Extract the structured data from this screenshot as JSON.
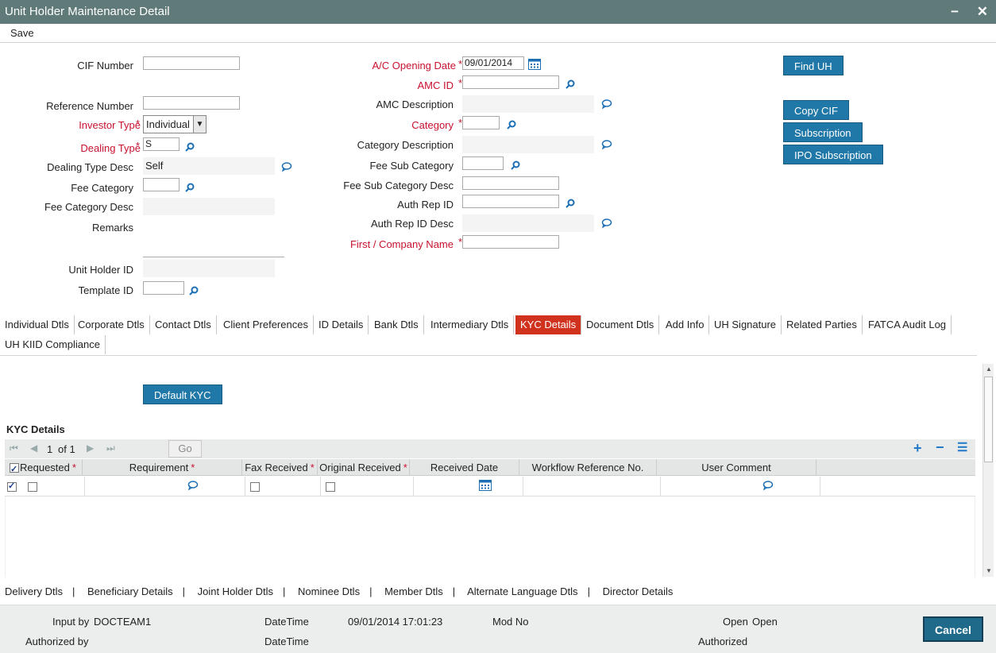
{
  "window": {
    "title": "Unit Holder Maintenance Detail",
    "minimize": "−",
    "close": "✕"
  },
  "menu": {
    "save": "Save"
  },
  "left": {
    "cif_number": "CIF Number",
    "reference_number": "Reference Number",
    "investor_type": "Investor Type",
    "investor_type_value": "Individual",
    "dealing_type": "Dealing Type",
    "dealing_type_value": "S",
    "dealing_type_desc": "Dealing Type Desc",
    "dealing_type_desc_value": "Self",
    "fee_category": "Fee Category",
    "fee_category_desc": "Fee Category Desc",
    "remarks": "Remarks",
    "unit_holder_id": "Unit Holder ID",
    "template_id": "Template ID"
  },
  "middle": {
    "ac_opening_date": "A/C Opening Date",
    "ac_opening_date_value": "09/01/2014",
    "amc_id": "AMC ID",
    "amc_description": "AMC Description",
    "category": "Category",
    "category_description": "Category Description",
    "fee_sub_category": "Fee Sub Category",
    "fee_sub_category_desc": "Fee Sub Category Desc",
    "auth_rep_id": "Auth Rep ID",
    "auth_rep_id_desc": "Auth Rep ID Desc",
    "first_company_name": "First / Company Name"
  },
  "right_buttons": {
    "find_uh": "Find UH",
    "copy_cif": "Copy CIF",
    "subscription": "Subscription",
    "ipo_subscription": "IPO Subscription"
  },
  "required_mark": "*",
  "tabs": [
    "Individual Dtls",
    "Corporate Dtls",
    "Contact Dtls",
    "Client Preferences",
    "ID Details",
    "Bank Dtls",
    "Intermediary Dtls",
    "KYC Details",
    "Document Dtls",
    "Add Info",
    "UH Signature",
    "Related Parties",
    "FATCA Audit Log",
    "UH KIID Compliance"
  ],
  "kyc": {
    "default_button": "Default KYC",
    "section_title": "KYC Details",
    "page_current": "1",
    "page_of": "of 1",
    "go": "Go",
    "columns": [
      "Requested",
      "Requirement",
      "Fax Received",
      "Original Received",
      "Received Date",
      "Workflow Reference No.",
      "User Comment"
    ]
  },
  "bottom_links": [
    "Delivery Dtls",
    "Beneficiary Details",
    "Joint Holder Dtls",
    "Nominee Dtls",
    "Member Dtls",
    "Alternate Language Dtls",
    "Director Details"
  ],
  "link_separator": "|",
  "footer": {
    "input_by_label": "Input by",
    "input_by_value": "DOCTEAM1",
    "datetime_label": "DateTime",
    "datetime_value": "09/01/2014 17:01:23",
    "mod_no_label": "Mod No",
    "open_label": "Open",
    "open_value": "Open",
    "authorized_by_label": "Authorized by",
    "datetime2_label": "DateTime",
    "authorized_label": "Authorized",
    "cancel": "Cancel"
  },
  "colors": {
    "title_bar": "#5f7a78",
    "button": "#1f78a8",
    "active_tab": "#d0321e",
    "required": "#c8102e"
  }
}
